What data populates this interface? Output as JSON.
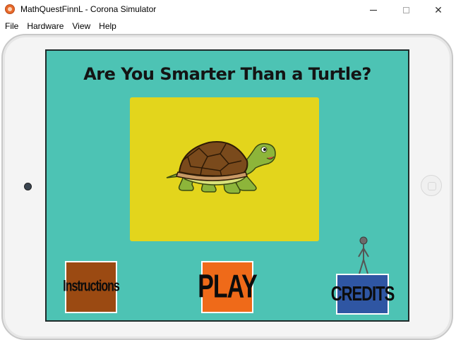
{
  "window": {
    "title": "MathQuestFinnL - Corona Simulator",
    "close_glyph": "✕"
  },
  "menubar": {
    "items": [
      "File",
      "Hardware",
      "View",
      "Help"
    ]
  },
  "game": {
    "title": "Are You Smarter Than a Turtle?",
    "buttons": {
      "instructions": "Instructions",
      "play": "PLAY",
      "credits": "CREDITS"
    }
  },
  "colors": {
    "screen_bg": "#4dc3b4",
    "panel": "#e3d51c",
    "instructions_btn": "#9b4a12",
    "play_btn": "#ef6a19",
    "credits_btn": "#2f56a3"
  },
  "icons": {
    "app": "corona-simulator-icon",
    "turtle": "turtle-illustration",
    "figure": "stick-figure-icon"
  }
}
